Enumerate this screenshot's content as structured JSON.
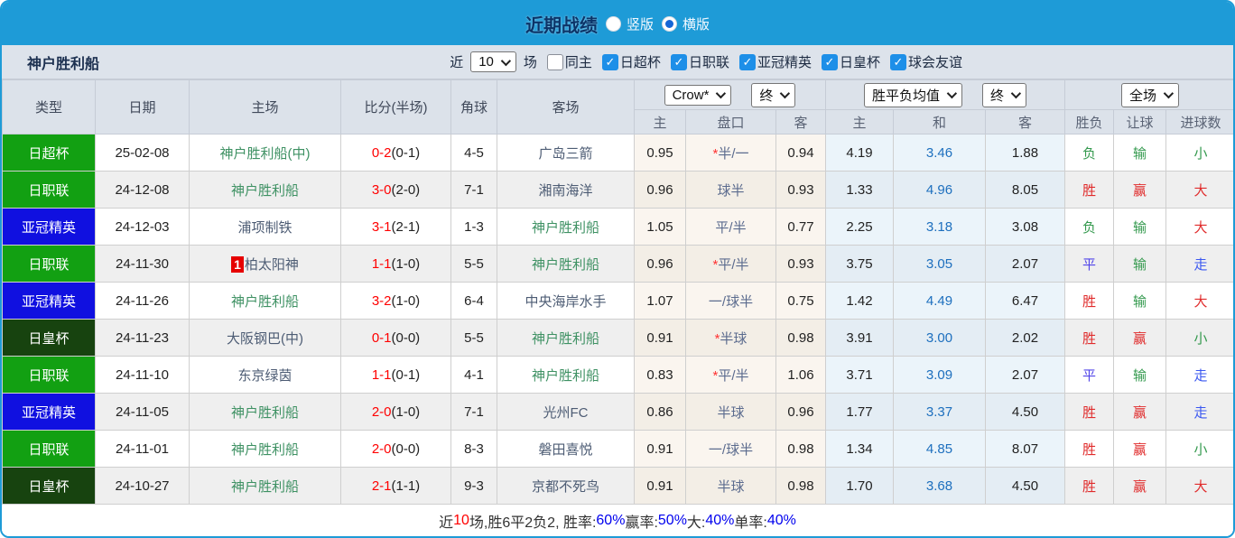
{
  "colors": {
    "accent_bar": "#1E9BD7",
    "badge_green": "#12A012",
    "badge_blue": "#1010E0",
    "badge_darkgreen": "#17430F",
    "focus_team_green": "#3E9163",
    "score_red": "#FF0000",
    "avg_draw_blue": "#1D6FBE",
    "result_red": "#E02B2B",
    "result_green": "#33994D",
    "result_violet": "#5246E9",
    "result_blue": "#3A57F0",
    "checkbox_blue": "#1D8FE8"
  },
  "header": {
    "title": "近期战绩",
    "radio_options": [
      {
        "label": "竖版",
        "selected": false
      },
      {
        "label": "横版",
        "selected": true
      }
    ]
  },
  "filter": {
    "team": "神户胜利船",
    "near_label": "近",
    "count": "10",
    "games_label": "场",
    "checkboxes": [
      {
        "label": "同主",
        "checked": false
      },
      {
        "label": "日超杯",
        "checked": true
      },
      {
        "label": "日职联",
        "checked": true
      },
      {
        "label": "亚冠精英",
        "checked": true
      },
      {
        "label": "日皇杯",
        "checked": true
      },
      {
        "label": "球会友谊",
        "checked": true
      }
    ]
  },
  "table": {
    "static_headers": [
      "类型",
      "日期",
      "主场",
      "比分(半场)",
      "角球",
      "客场"
    ],
    "selects": {
      "odds_source": "Crow*",
      "odds_period": "终",
      "avg_source": "胜平负均值",
      "avg_period": "终",
      "result_scope": "全场"
    },
    "sub_headers": [
      "主",
      "盘口",
      "客",
      "主",
      "和",
      "客",
      "胜负",
      "让球",
      "进球数"
    ],
    "rows": [
      {
        "type": "日超杯",
        "type_color": "green",
        "date": "25-02-08",
        "home": "神户胜利船(中)",
        "home_focus": true,
        "home_rank": "",
        "score": "0-2",
        "half": "(0-1)",
        "corners": "4-5",
        "away": "广岛三箭",
        "away_focus": false,
        "odds_home": "0.95",
        "handicap_star": "*",
        "handicap": "半/一",
        "odds_away": "0.94",
        "avg_home": "4.19",
        "avg_draw": "3.46",
        "avg_away": "1.88",
        "wdl": "负",
        "wdl_color": "green",
        "handicap_result": "输",
        "handicap_result_color": "green",
        "goals": "小",
        "goals_color": "green"
      },
      {
        "type": "日职联",
        "type_color": "green",
        "date": "24-12-08",
        "home": "神户胜利船",
        "home_focus": true,
        "home_rank": "",
        "score": "3-0",
        "half": "(2-0)",
        "corners": "7-1",
        "away": "湘南海洋",
        "away_focus": false,
        "odds_home": "0.96",
        "handicap_star": "",
        "handicap": "球半",
        "odds_away": "0.93",
        "avg_home": "1.33",
        "avg_draw": "4.96",
        "avg_away": "8.05",
        "wdl": "胜",
        "wdl_color": "red",
        "handicap_result": "赢",
        "handicap_result_color": "red",
        "goals": "大",
        "goals_color": "red"
      },
      {
        "type": "亚冠精英",
        "type_color": "blue",
        "date": "24-12-03",
        "home": "浦项制铁",
        "home_focus": false,
        "home_rank": "",
        "score": "3-1",
        "half": "(2-1)",
        "corners": "1-3",
        "away": "神户胜利船",
        "away_focus": true,
        "odds_home": "1.05",
        "handicap_star": "",
        "handicap": "平/半",
        "odds_away": "0.77",
        "avg_home": "2.25",
        "avg_draw": "3.18",
        "avg_away": "3.08",
        "wdl": "负",
        "wdl_color": "green",
        "handicap_result": "输",
        "handicap_result_color": "green",
        "goals": "大",
        "goals_color": "red"
      },
      {
        "type": "日职联",
        "type_color": "green",
        "date": "24-11-30",
        "home": "柏太阳神",
        "home_focus": false,
        "home_rank": "1",
        "score": "1-1",
        "half": "(1-0)",
        "corners": "5-5",
        "away": "神户胜利船",
        "away_focus": true,
        "odds_home": "0.96",
        "handicap_star": "*",
        "handicap": "平/半",
        "odds_away": "0.93",
        "avg_home": "3.75",
        "avg_draw": "3.05",
        "avg_away": "2.07",
        "wdl": "平",
        "wdl_color": "violet",
        "handicap_result": "输",
        "handicap_result_color": "green",
        "goals": "走",
        "goals_color": "blue"
      },
      {
        "type": "亚冠精英",
        "type_color": "blue",
        "date": "24-11-26",
        "home": "神户胜利船",
        "home_focus": true,
        "home_rank": "",
        "score": "3-2",
        "half": "(1-0)",
        "corners": "6-4",
        "away": "中央海岸水手",
        "away_focus": false,
        "odds_home": "1.07",
        "handicap_star": "",
        "handicap": "一/球半",
        "odds_away": "0.75",
        "avg_home": "1.42",
        "avg_draw": "4.49",
        "avg_away": "6.47",
        "wdl": "胜",
        "wdl_color": "red",
        "handicap_result": "输",
        "handicap_result_color": "green",
        "goals": "大",
        "goals_color": "red"
      },
      {
        "type": "日皇杯",
        "type_color": "darkgreen",
        "date": "24-11-23",
        "home": "大阪钢巴(中)",
        "home_focus": false,
        "home_rank": "",
        "score": "0-1",
        "half": "(0-0)",
        "corners": "5-5",
        "away": "神户胜利船",
        "away_focus": true,
        "odds_home": "0.91",
        "handicap_star": "*",
        "handicap": "半球",
        "odds_away": "0.98",
        "avg_home": "3.91",
        "avg_draw": "3.00",
        "avg_away": "2.02",
        "wdl": "胜",
        "wdl_color": "red",
        "handicap_result": "赢",
        "handicap_result_color": "red",
        "goals": "小",
        "goals_color": "green"
      },
      {
        "type": "日职联",
        "type_color": "green",
        "date": "24-11-10",
        "home": "东京绿茵",
        "home_focus": false,
        "home_rank": "",
        "score": "1-1",
        "half": "(0-1)",
        "corners": "4-1",
        "away": "神户胜利船",
        "away_focus": true,
        "odds_home": "0.83",
        "handicap_star": "*",
        "handicap": "平/半",
        "odds_away": "1.06",
        "avg_home": "3.71",
        "avg_draw": "3.09",
        "avg_away": "2.07",
        "wdl": "平",
        "wdl_color": "violet",
        "handicap_result": "输",
        "handicap_result_color": "green",
        "goals": "走",
        "goals_color": "blue"
      },
      {
        "type": "亚冠精英",
        "type_color": "blue",
        "date": "24-11-05",
        "home": "神户胜利船",
        "home_focus": true,
        "home_rank": "",
        "score": "2-0",
        "half": "(1-0)",
        "corners": "7-1",
        "away": "光州FC",
        "away_focus": false,
        "odds_home": "0.86",
        "handicap_star": "",
        "handicap": "半球",
        "odds_away": "0.96",
        "avg_home": "1.77",
        "avg_draw": "3.37",
        "avg_away": "4.50",
        "wdl": "胜",
        "wdl_color": "red",
        "handicap_result": "赢",
        "handicap_result_color": "red",
        "goals": "走",
        "goals_color": "blue"
      },
      {
        "type": "日职联",
        "type_color": "green",
        "date": "24-11-01",
        "home": "神户胜利船",
        "home_focus": true,
        "home_rank": "",
        "score": "2-0",
        "half": "(0-0)",
        "corners": "8-3",
        "away": "磐田喜悦",
        "away_focus": false,
        "odds_home": "0.91",
        "handicap_star": "",
        "handicap": "一/球半",
        "odds_away": "0.98",
        "avg_home": "1.34",
        "avg_draw": "4.85",
        "avg_away": "8.07",
        "wdl": "胜",
        "wdl_color": "red",
        "handicap_result": "赢",
        "handicap_result_color": "red",
        "goals": "小",
        "goals_color": "green"
      },
      {
        "type": "日皇杯",
        "type_color": "darkgreen",
        "date": "24-10-27",
        "home": "神户胜利船",
        "home_focus": true,
        "home_rank": "",
        "score": "2-1",
        "half": "(1-1)",
        "corners": "9-3",
        "away": "京都不死鸟",
        "away_focus": false,
        "odds_home": "0.91",
        "handicap_star": "",
        "handicap": "半球",
        "odds_away": "0.98",
        "avg_home": "1.70",
        "avg_draw": "3.68",
        "avg_away": "4.50",
        "wdl": "胜",
        "wdl_color": "red",
        "handicap_result": "赢",
        "handicap_result_color": "red",
        "goals": "大",
        "goals_color": "red"
      }
    ]
  },
  "footer": {
    "segments": [
      {
        "text": "近",
        "color": "dark"
      },
      {
        "text": "10",
        "color": "red"
      },
      {
        "text": "场,胜6平2负2, 胜率:",
        "color": "dark"
      },
      {
        "text": "60%",
        "color": "blue"
      },
      {
        "text": " 赢率:",
        "color": "dark"
      },
      {
        "text": "50%",
        "color": "blue"
      },
      {
        "text": " 大:",
        "color": "dark"
      },
      {
        "text": "40%",
        "color": "blue"
      },
      {
        "text": " 单率:",
        "color": "dark"
      },
      {
        "text": "40%",
        "color": "blue"
      }
    ]
  }
}
